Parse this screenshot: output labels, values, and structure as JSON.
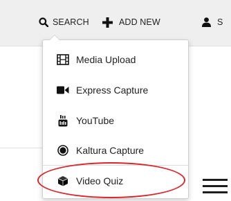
{
  "header": {
    "search_label": "SEARCH",
    "add_new_label": "ADD NEW",
    "user_label_partial": "S",
    "icons": {
      "search": "search-icon",
      "add": "plus-icon",
      "user": "user-icon"
    }
  },
  "add_new_menu": {
    "items": [
      {
        "label": "Media Upload",
        "icon": "film-icon"
      },
      {
        "label": "Express Capture",
        "icon": "video-camera-icon"
      },
      {
        "label": "YouTube",
        "icon": "youtube-icon"
      },
      {
        "label": "Kaltura Capture",
        "icon": "record-icon"
      },
      {
        "label": "Video Quiz",
        "icon": "cube-icon",
        "highlighted": true
      }
    ]
  },
  "colors": {
    "topbar_bg": "#efefef",
    "highlight": "#d9262c",
    "text": "#222222"
  }
}
